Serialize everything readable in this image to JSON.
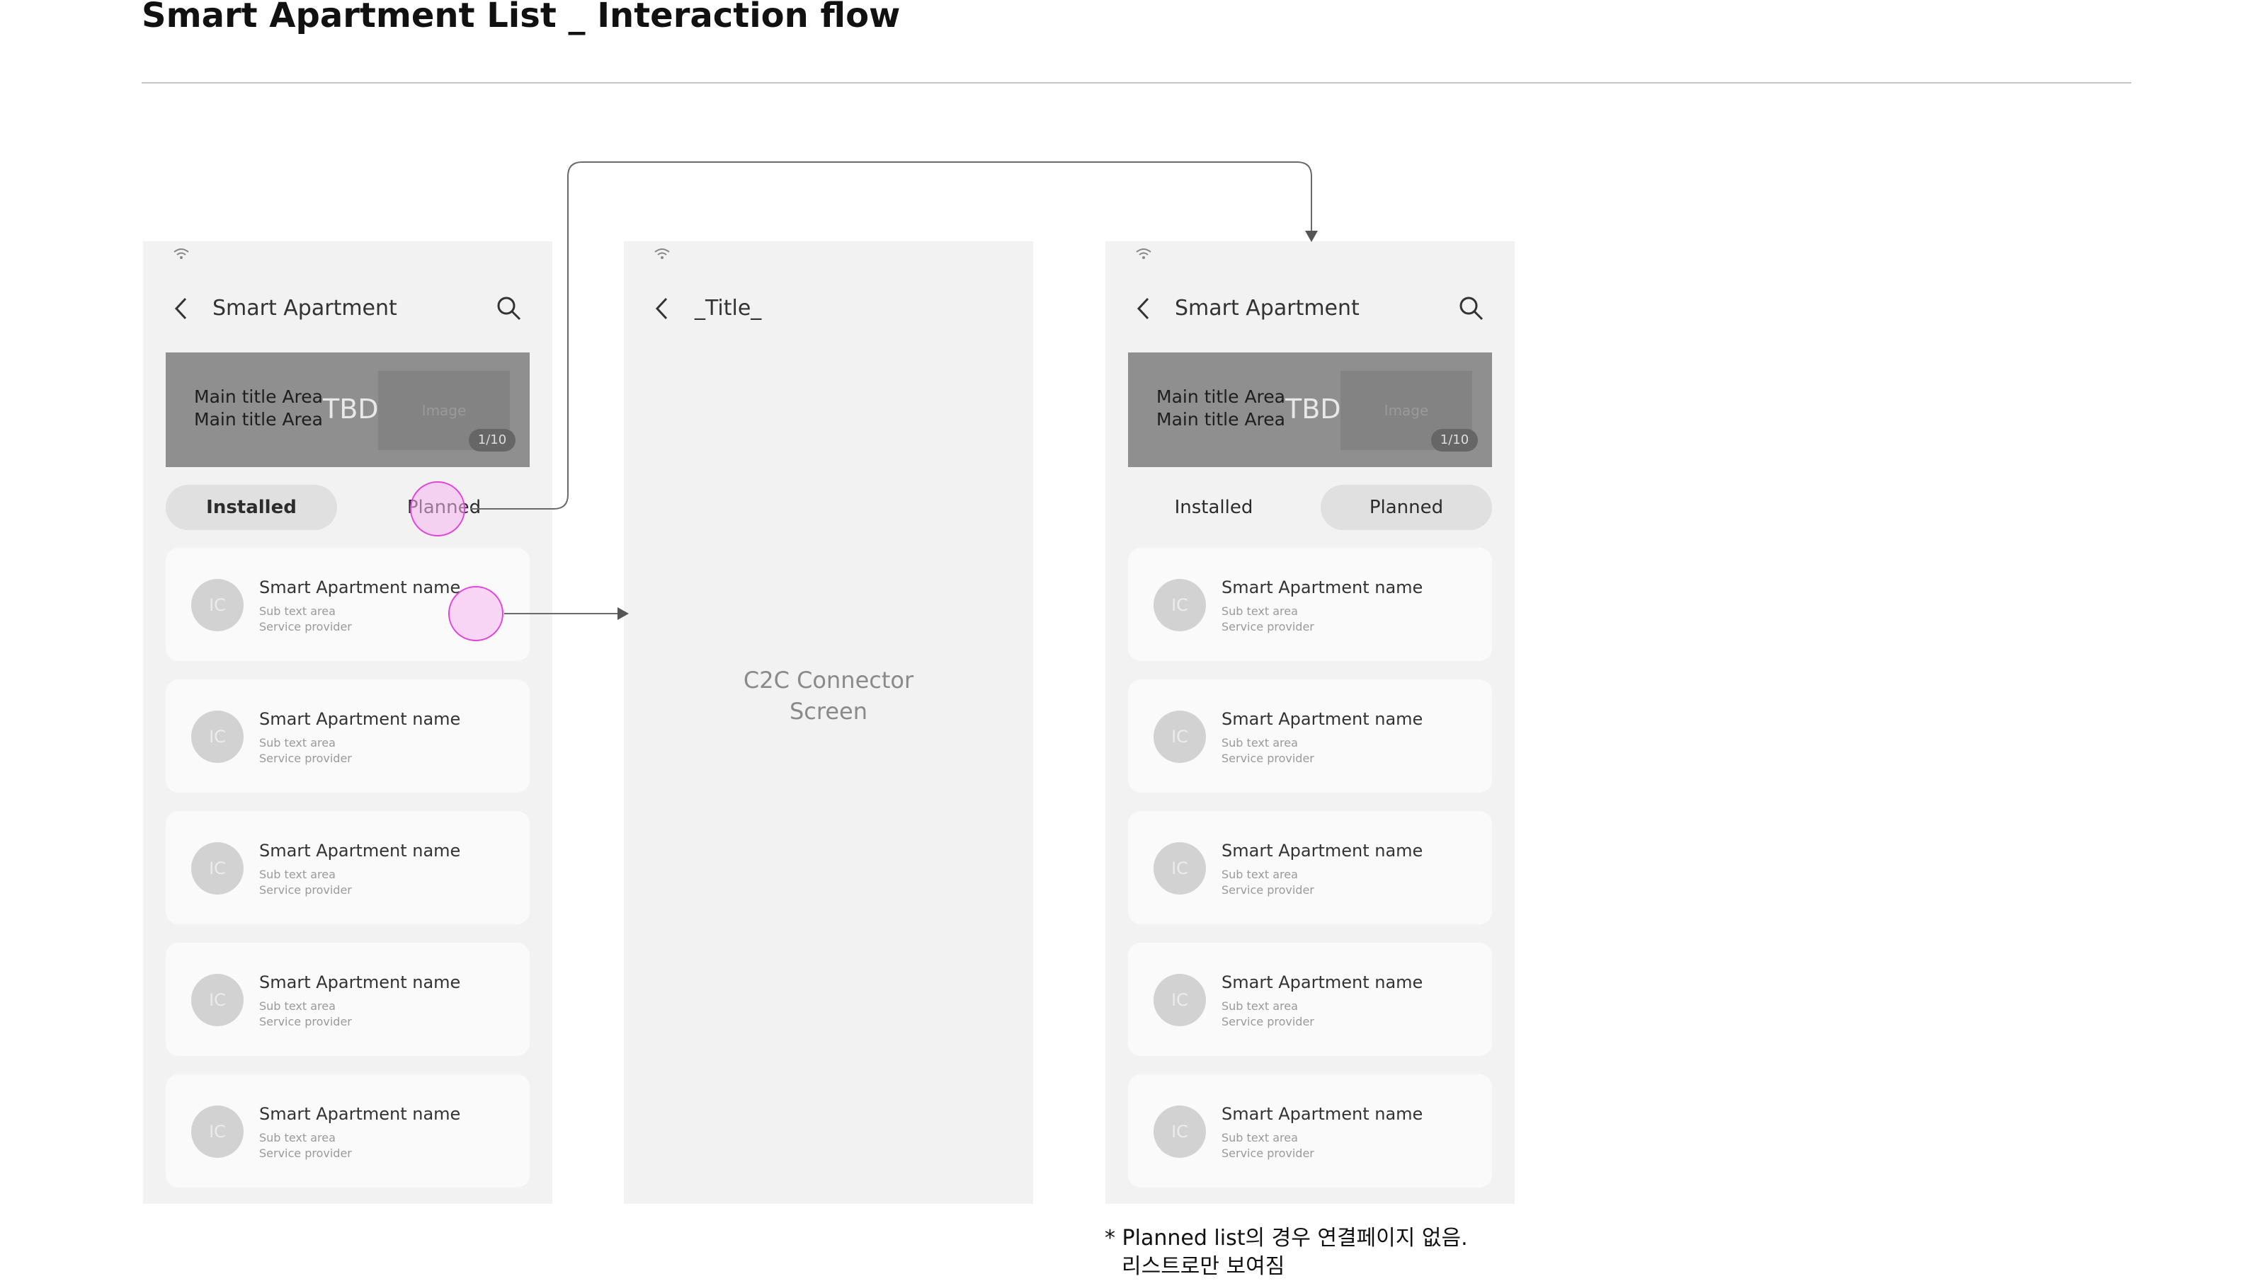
{
  "page": {
    "title": "Smart Apartment List _ Interaction flow"
  },
  "screen_list": {
    "header_title": "Smart Apartment",
    "banner": {
      "line1": "Main title Area",
      "line2": "Main title Area",
      "tbd": "TBD",
      "image_label": "Image",
      "page": "1/10"
    },
    "tabs": {
      "installed": "Installed",
      "planned": "Planned",
      "active": "Installed"
    },
    "items": [
      {
        "icon": "IC",
        "name": "Smart Apartment name",
        "sub": "Sub text area",
        "provider": "Service provider"
      },
      {
        "icon": "IC",
        "name": "Smart Apartment name",
        "sub": "Sub text area",
        "provider": "Service provider"
      },
      {
        "icon": "IC",
        "name": "Smart Apartment name",
        "sub": "Sub text area",
        "provider": "Service provider"
      },
      {
        "icon": "IC",
        "name": "Smart Apartment name",
        "sub": "Sub text area",
        "provider": "Service provider"
      },
      {
        "icon": "IC",
        "name": "Smart Apartment name",
        "sub": "Sub text area",
        "provider": "Service provider"
      }
    ]
  },
  "screen_c2c": {
    "header_title": "_Title_",
    "body_line1": "C2C Connector",
    "body_line2": "Screen"
  },
  "screen_planned": {
    "header_title": "Smart Apartment",
    "banner": {
      "line1": "Main title Area",
      "line2": "Main title Area",
      "tbd": "TBD",
      "image_label": "Image",
      "page": "1/10"
    },
    "tabs": {
      "installed": "Installed",
      "planned": "Planned",
      "active": "Planned"
    },
    "items": [
      {
        "icon": "IC",
        "name": "Smart Apartment name",
        "sub": "Sub text area",
        "provider": "Service provider"
      },
      {
        "icon": "IC",
        "name": "Smart Apartment name",
        "sub": "Sub text area",
        "provider": "Service provider"
      },
      {
        "icon": "IC",
        "name": "Smart Apartment name",
        "sub": "Sub text area",
        "provider": "Service provider"
      },
      {
        "icon": "IC",
        "name": "Smart Apartment name",
        "sub": "Sub text area",
        "provider": "Service provider"
      },
      {
        "icon": "IC",
        "name": "Smart Apartment name",
        "sub": "Sub text area",
        "provider": "Service provider"
      }
    ]
  },
  "note": {
    "line1": "* Planned list의 경우 연결페이지 없음.",
    "line2": "리스트로만 보여짐"
  },
  "colors": {
    "screen_bg": "#f2f2f2",
    "card_bg": "#fafafa",
    "tap_fill": "#f6b4f0",
    "tap_stroke": "#e046d8",
    "connector": "#6a6a6a"
  }
}
